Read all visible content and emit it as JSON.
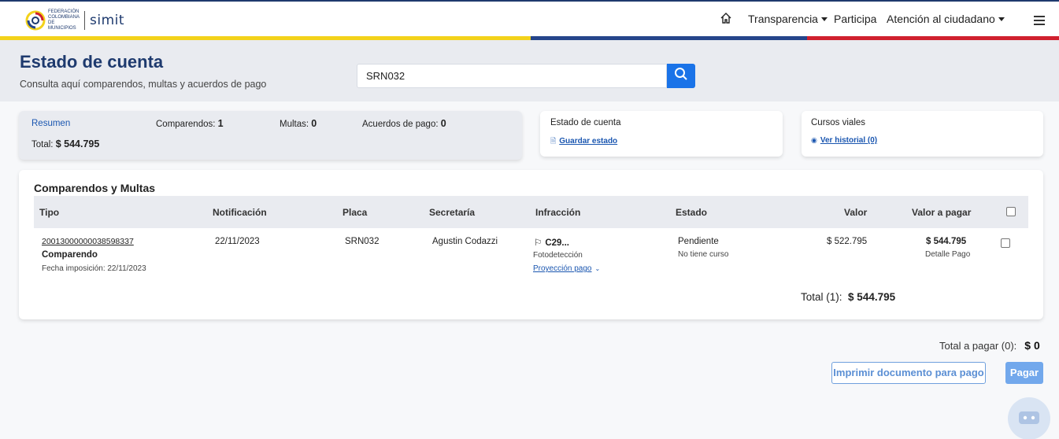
{
  "header": {
    "logo_text": "Federación Colombiana de Municipios",
    "logo_brand": "simit",
    "nav": [
      {
        "label": "Transparencia",
        "dropdown": true
      },
      {
        "label": "Participa",
        "dropdown": false
      },
      {
        "label": "Atención al ciudadano",
        "dropdown": true
      }
    ],
    "icons": [
      "home-icon",
      "menu-icon"
    ],
    "stripe_colors": [
      "#f3d21b",
      "#25458b",
      "#d0202e"
    ]
  },
  "hero": {
    "title": "Estado de cuenta",
    "subtitle": "Consulta aquí comparendos, multas y acuerdos de pago",
    "search_value": "SRN032"
  },
  "summary": {
    "resumen_label": "Resumen",
    "comparendos_label": "Comparendos:",
    "comparendos_value": "1",
    "multas_label": "Multas:",
    "multas_value": "0",
    "acuerdos_label": "Acuerdos de pago:",
    "acuerdos_value": "0",
    "total_label": "Total:",
    "total_value": "$ 544.795"
  },
  "estado_card": {
    "title": "Estado de cuenta",
    "link": "Guardar estado"
  },
  "cursos_card": {
    "title": "Cursos viales",
    "link": "Ver historial (0)"
  },
  "table": {
    "title": "Comparendos y Multas",
    "columns": [
      "Tipo",
      "Notificación",
      "Placa",
      "Secretaría",
      "Infracción",
      "Estado",
      "Valor",
      "Valor a pagar"
    ],
    "rows": [
      {
        "numero": "20013000000038598337",
        "tipo": "Comparendo",
        "fecha_imposicion": "Fecha imposición: 22/11/2023",
        "notificacion": "22/11/2023",
        "placa": "SRN032",
        "secretaria": "Agustin Codazzi",
        "infraccion": "C29...",
        "infraccion_tipo": "Fotodetección",
        "proyeccion": "Proyección pago",
        "estado": "Pendiente",
        "estado_sub": "No tiene curso",
        "valor": "$ 522.795",
        "valor_pagar": "$ 544.795",
        "detalle": "Detalle Pago"
      }
    ],
    "total_label": "Total (1):",
    "total_value": "$ 544.795"
  },
  "footer": {
    "total_pagar_label": "Total a pagar (0):",
    "total_pagar_value": "$ 0",
    "print_button": "Imprimir documento para pago",
    "pay_button": "Pagar"
  },
  "colors": {
    "brand_blue": "#1e3a6e",
    "accent": "#1a73e8",
    "link": "#1a56b0"
  }
}
